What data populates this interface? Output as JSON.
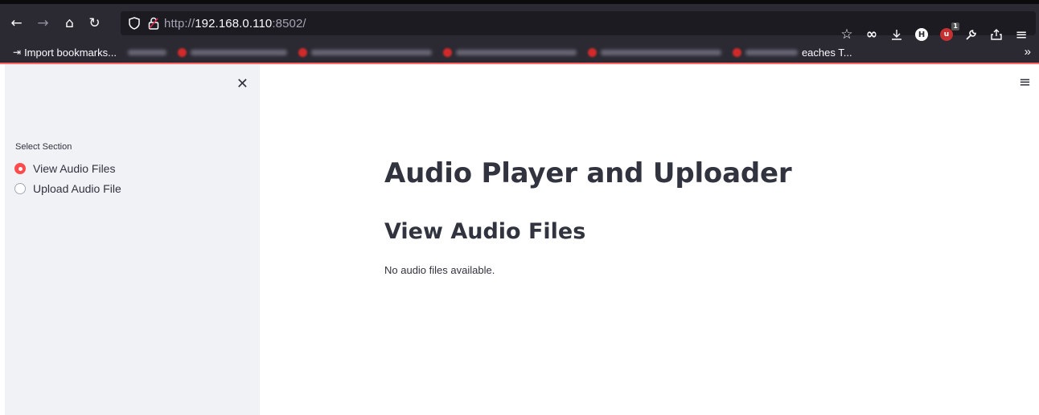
{
  "browser": {
    "url_scheme": "http://",
    "url_host": "192.168.0.110",
    "url_port": ":8502/",
    "nav": {
      "back_icon": "←",
      "forward_icon": "→",
      "home_icon": "⌂",
      "reload_icon": "↻"
    },
    "extension_badge_count": "1",
    "bookmarks": {
      "import_label": "Import bookmarks...",
      "visible_tail": "eaches T..."
    }
  },
  "sidebar": {
    "close_icon": "✕",
    "label": "Select Section",
    "options": [
      {
        "label": "View Audio Files",
        "selected": true
      },
      {
        "label": "Upload Audio File",
        "selected": false
      }
    ]
  },
  "main": {
    "menu_icon": "≡",
    "title": "Audio Player and Uploader",
    "subheader": "View Audio Files",
    "message": "No audio files available."
  },
  "colors": {
    "accent": "#ff4b4b",
    "sidebar_bg": "#f0f2f6",
    "text": "#31333f",
    "browser_toolbar": "#2b2a33"
  }
}
